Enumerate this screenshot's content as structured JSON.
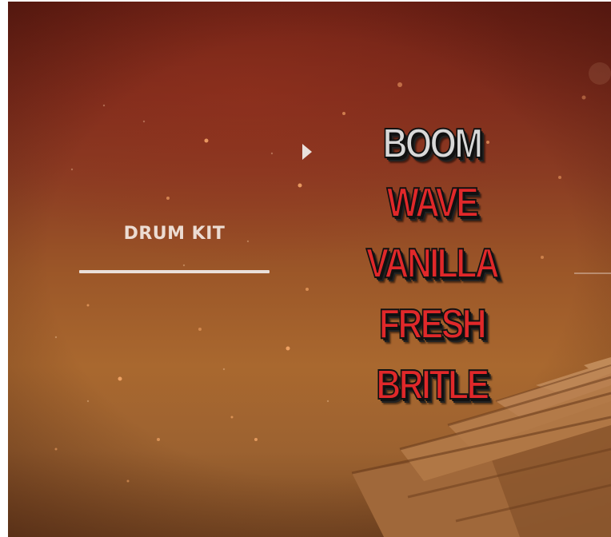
{
  "panel": {
    "section_label": "DRUM KIT",
    "selector_icon": "play-triangle-icon"
  },
  "kits": [
    {
      "label": "BOOM",
      "selected": true
    },
    {
      "label": "WAVE",
      "selected": false
    },
    {
      "label": "VANILLA",
      "selected": false
    },
    {
      "label": "FRESH",
      "selected": false
    },
    {
      "label": "BRITLE",
      "selected": false
    }
  ],
  "colors": {
    "selected_kit": "#d8d8d8",
    "kit": "#e0282a",
    "accent_line": "#eae0da"
  }
}
